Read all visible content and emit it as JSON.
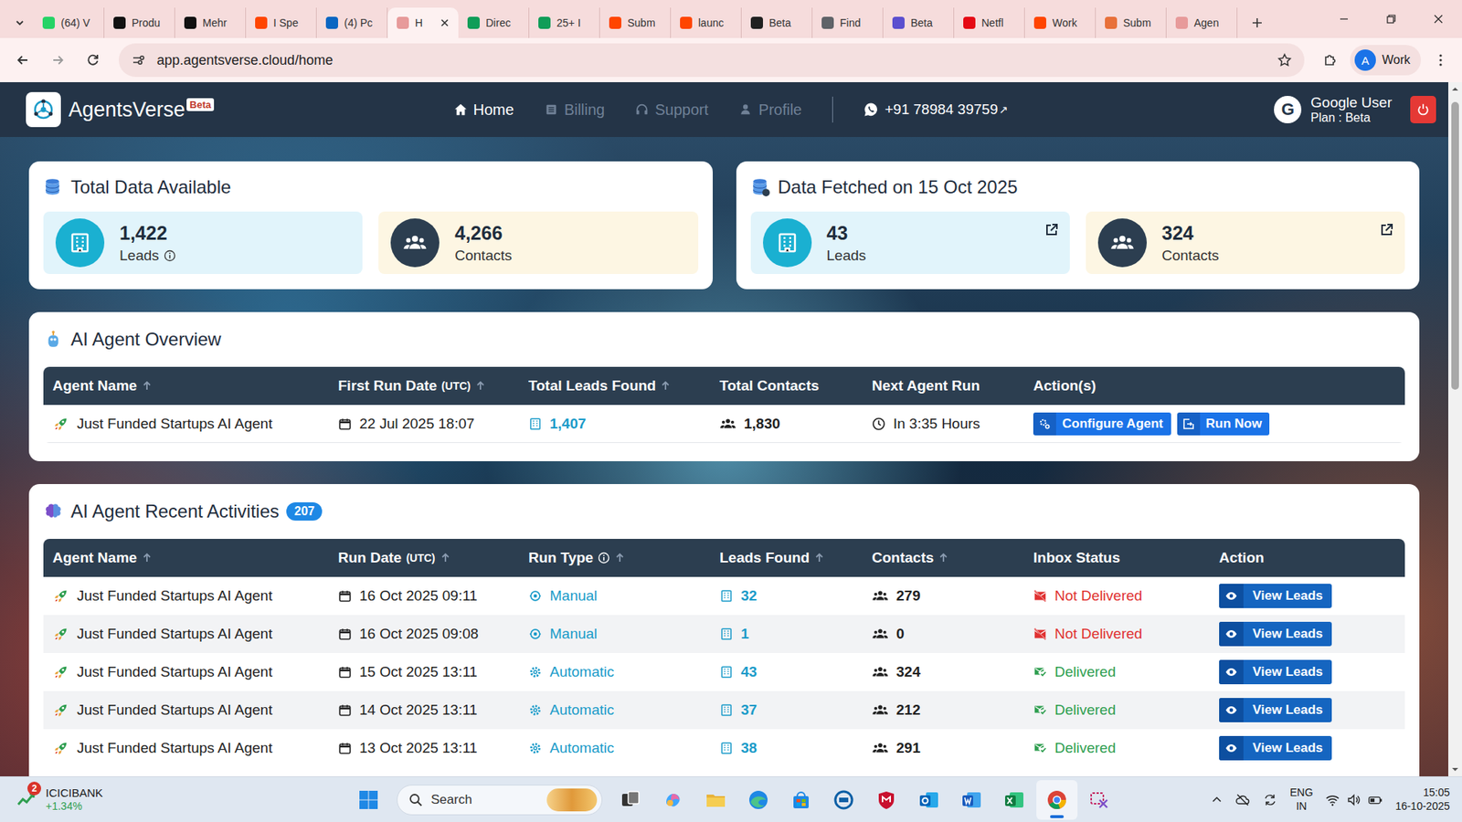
{
  "browser": {
    "tabs": [
      {
        "label": "(64) V",
        "selected": false,
        "color": "#25d366"
      },
      {
        "label": "Produ",
        "selected": false,
        "color": "#111111"
      },
      {
        "label": "Mehr",
        "selected": false,
        "color": "#111111"
      },
      {
        "label": "I Spe",
        "selected": false,
        "color": "#ff4500"
      },
      {
        "label": "(4) Pc",
        "selected": false,
        "color": "#0a66c2"
      },
      {
        "label": "H",
        "selected": true,
        "color": "#e79a9a"
      },
      {
        "label": "Direc",
        "selected": false,
        "color": "#0f9d58"
      },
      {
        "label": "25+ I",
        "selected": false,
        "color": "#0f9d58"
      },
      {
        "label": "Subm",
        "selected": false,
        "color": "#ff4500"
      },
      {
        "label": "launc",
        "selected": false,
        "color": "#ff4500"
      },
      {
        "label": "Beta",
        "selected": false,
        "color": "#202020"
      },
      {
        "label": "Find",
        "selected": false,
        "color": "#5f6368"
      },
      {
        "label": "Beta",
        "selected": false,
        "color": "#5b4fcf"
      },
      {
        "label": "Netfl",
        "selected": false,
        "color": "#e50914"
      },
      {
        "label": "Work",
        "selected": false,
        "color": "#ff4500"
      },
      {
        "label": "Subm",
        "selected": false,
        "color": "#e8703a"
      },
      {
        "label": "Agen",
        "selected": false,
        "color": "#e79a9a"
      }
    ],
    "address": "app.agentsverse.cloud/home",
    "profile": {
      "initial": "A",
      "label": "Work"
    }
  },
  "app": {
    "logo": "AgentsVerse",
    "badge": "Beta",
    "nav": [
      {
        "label": "Home",
        "selected": true
      },
      {
        "label": "Billing",
        "selected": false
      },
      {
        "label": "Support",
        "selected": false
      },
      {
        "label": "Profile",
        "selected": false
      }
    ],
    "phone": "+91 78984 39759",
    "phone_arrow": "↗",
    "user": {
      "initial": "G",
      "name": "Google User",
      "plan": "Plan : Beta"
    }
  },
  "summary_cards": [
    {
      "title": "Total Data Available",
      "stats": [
        {
          "value": "1,422",
          "label": "Leads",
          "kind": "leads",
          "info": true,
          "external": false
        },
        {
          "value": "4,266",
          "label": "Contacts",
          "kind": "contacts",
          "info": false,
          "external": false
        }
      ]
    },
    {
      "title": "Data Fetched on 15 Oct 2025",
      "stats": [
        {
          "value": "43",
          "label": "Leads",
          "kind": "leads",
          "info": false,
          "external": true
        },
        {
          "value": "324",
          "label": "Contacts",
          "kind": "contacts",
          "info": false,
          "external": true
        }
      ]
    }
  ],
  "overview": {
    "title": "AI Agent Overview",
    "columns": [
      {
        "label": "Agent Name",
        "sortable": true
      },
      {
        "label": "First Run Date",
        "unit": "(UTC)",
        "sortable": true
      },
      {
        "label": "Total Leads Found",
        "sortable": true
      },
      {
        "label": "Total Contacts",
        "sortable": false
      },
      {
        "label": "Next Agent Run",
        "sortable": false
      },
      {
        "label": "Action(s)",
        "sortable": false
      }
    ],
    "rows": [
      {
        "agent": "Just Funded Startups AI Agent",
        "first_run": "22 Jul 2025 18:07",
        "leads": "1,407",
        "contacts": "1,830",
        "next_run": "In 3:35 Hours",
        "actions": [
          {
            "label": "Configure Agent",
            "kind": "configure"
          },
          {
            "label": "Run Now",
            "kind": "run"
          }
        ]
      }
    ]
  },
  "activities": {
    "title": "AI Agent Recent Activities",
    "count": "207",
    "columns": [
      {
        "label": "Agent Name",
        "sortable": true,
        "info": false
      },
      {
        "label": "Run Date",
        "unit": "(UTC)",
        "sortable": true,
        "info": false
      },
      {
        "label": "Run Type",
        "sortable": true,
        "info": true
      },
      {
        "label": "Leads Found",
        "sortable": true,
        "info": false
      },
      {
        "label": "Contacts",
        "sortable": true,
        "info": false
      },
      {
        "label": "Inbox Status",
        "sortable": false,
        "info": false
      },
      {
        "label": "Action",
        "sortable": false,
        "info": false
      }
    ],
    "rows": [
      {
        "agent": "Just Funded Startups AI Agent",
        "date": "16 Oct 2025 09:11",
        "run_type": "Manual",
        "kind": "manual",
        "leads": "32",
        "contacts": "279",
        "inbox": "Not Delivered",
        "delivered": false,
        "action": "View Leads"
      },
      {
        "agent": "Just Funded Startups AI Agent",
        "date": "16 Oct 2025 09:08",
        "run_type": "Manual",
        "kind": "manual",
        "leads": "1",
        "contacts": "0",
        "inbox": "Not Delivered",
        "delivered": false,
        "action": "View Leads"
      },
      {
        "agent": "Just Funded Startups AI Agent",
        "date": "15 Oct 2025 13:11",
        "run_type": "Automatic",
        "kind": "automatic",
        "leads": "43",
        "contacts": "324",
        "inbox": "Delivered",
        "delivered": true,
        "action": "View Leads"
      },
      {
        "agent": "Just Funded Startups AI Agent",
        "date": "14 Oct 2025 13:11",
        "run_type": "Automatic",
        "kind": "automatic",
        "leads": "37",
        "contacts": "212",
        "inbox": "Delivered",
        "delivered": true,
        "action": "View Leads"
      },
      {
        "agent": "Just Funded Startups AI Agent",
        "date": "13 Oct 2025 13:11",
        "run_type": "Automatic",
        "kind": "automatic",
        "leads": "38",
        "contacts": "291",
        "inbox": "Delivered",
        "delivered": true,
        "action": "View Leads"
      }
    ]
  },
  "taskbar": {
    "stock": {
      "name": "ICICIBANK",
      "change": "+1.34%",
      "badge": "2"
    },
    "search": "Search",
    "apps": [
      {
        "selected": false
      },
      {
        "selected": false
      },
      {
        "selected": false
      },
      {
        "selected": false
      },
      {
        "selected": false
      },
      {
        "selected": false
      },
      {
        "selected": false
      },
      {
        "selected": false
      },
      {
        "selected": false
      },
      {
        "selected": false
      },
      {
        "selected": true
      },
      {
        "selected": false
      }
    ],
    "language": "ENG",
    "region": "IN",
    "time": "15:05",
    "date": "16-10-2025"
  }
}
